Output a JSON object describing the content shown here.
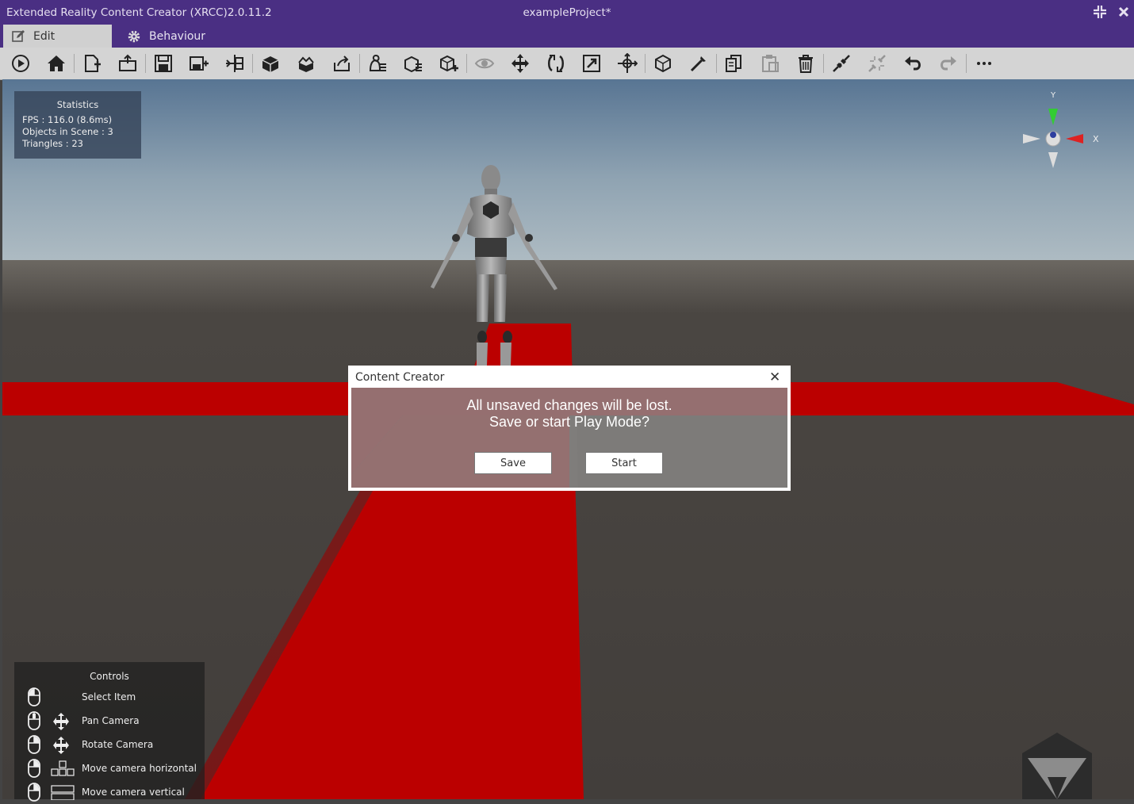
{
  "window": {
    "app_title": "Extended Reality Content Creator (XRCC)2.0.11.2",
    "project_title": "exampleProject*"
  },
  "tabs": [
    {
      "label": "Edit",
      "icon": "pencil-icon",
      "active": true
    },
    {
      "label": "Behaviour",
      "icon": "gear-icon",
      "active": false
    }
  ],
  "toolbar": {
    "icons": [
      "play-icon",
      "home-icon",
      "new-file-icon",
      "open-folder-icon",
      "save-icon",
      "save-as-icon",
      "import-icon",
      "package-icon",
      "unpack-icon",
      "export-icon",
      "behaviour-list-icon",
      "object-list-icon",
      "add-object-icon",
      "visibility-icon",
      "move-icon",
      "rotate-icon",
      "scale-icon",
      "pivot-icon",
      "local-space-icon",
      "tool-icon",
      "copy-icon",
      "paste-icon",
      "delete-icon",
      "connect-icon",
      "disconnect-icon",
      "undo-icon",
      "redo-icon",
      "more-icon"
    ]
  },
  "statistics": {
    "title": "Statistics",
    "fps": "FPS : 116.0 (8.6ms)",
    "objects": "Objects in Scene : 3",
    "triangles": "Triangles : 23"
  },
  "gizmo": {
    "y_label": "Y",
    "x_label": "X"
  },
  "dialog": {
    "title": "Content Creator",
    "message_line1": "All unsaved changes will be lost.",
    "message_line2": "Save or start Play Mode?",
    "save_label": "Save",
    "start_label": "Start"
  },
  "controls": {
    "title": "Controls",
    "items": [
      {
        "label": "Select Item",
        "icon": "mouse-icon"
      },
      {
        "label": "Pan Camera",
        "icon": "move-arrows-icon"
      },
      {
        "label": "Rotate Camera",
        "icon": "move-arrows-icon"
      },
      {
        "label": "Move camera horizontal",
        "icon": "keyboard-wasd-icon"
      },
      {
        "label": "Move camera vertical",
        "icon": "keyboard-space-icon"
      }
    ]
  },
  "colors": {
    "title_bar": "#4a2f83",
    "toolbar": "#d4d4d4",
    "floor_red": "#bb0000",
    "sky_top": "#5b7896",
    "ground": "#433f3c"
  }
}
